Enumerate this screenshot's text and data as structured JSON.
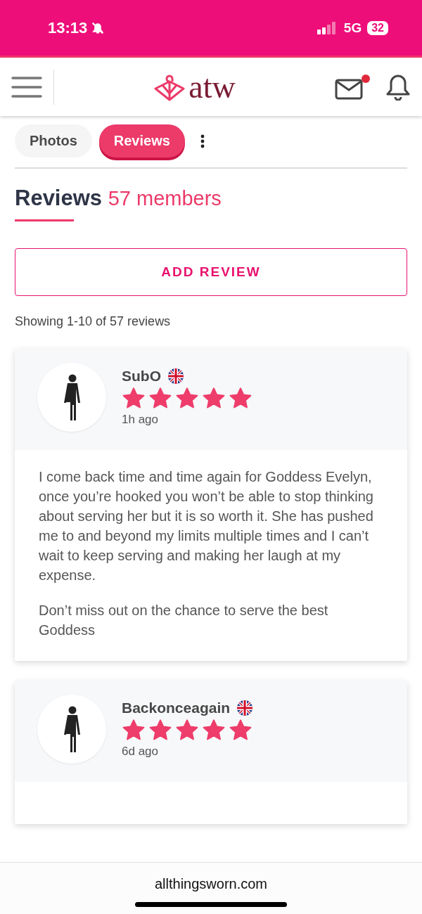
{
  "status_bar": {
    "time": "13:13",
    "network": "5G",
    "battery": "32"
  },
  "header": {
    "logo": "atw",
    "unread_messages": true
  },
  "tabs": [
    {
      "label": "Photos",
      "selected": false
    },
    {
      "label": "Reviews",
      "selected": true
    }
  ],
  "section": {
    "title": "Reviews",
    "count": "57 members"
  },
  "add_review_button": "ADD REVIEW",
  "showing": "Showing 1-10 of 57 reviews",
  "reviews": [
    {
      "name": "SubO",
      "stars": 5,
      "time": "1h ago",
      "paragraphs": [
        "I come back time and time again for Goddess Evelyn, once you’re hooked you won’t be able to stop thinking about serving her but it is so worth it. She has pushed me to and beyond my limits multiple times and I can’t wait to keep serving and making her laugh at my expense.",
        "Don’t miss out on the chance to serve the best Goddess"
      ]
    },
    {
      "name": "Backonceagain",
      "stars": 5,
      "time": "6d ago"
    }
  ],
  "browser": {
    "url": "allthingsworn.com"
  }
}
